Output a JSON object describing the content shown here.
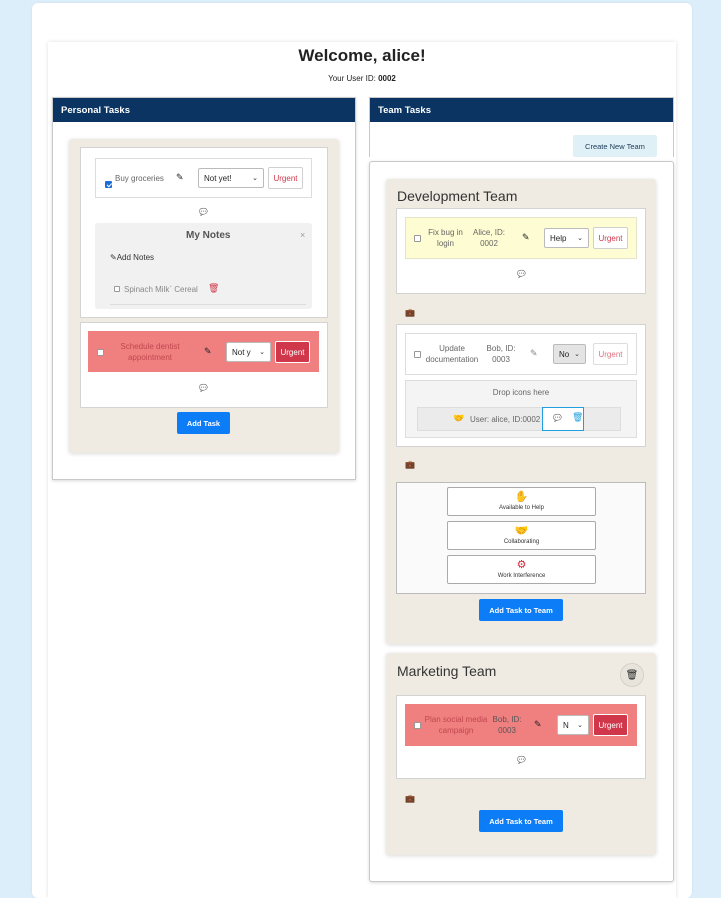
{
  "header": {
    "welcome": "Welcome, alice!",
    "user_id_label": "Your User ID: ",
    "user_id": "0002"
  },
  "personal": {
    "title": "Personal Tasks",
    "tasks": [
      {
        "label": "Buy groceries",
        "checked": true,
        "status": "Not yet!",
        "urgent": "Urgent",
        "urgent_active": false
      },
      {
        "label": "Schedule dentist appointment",
        "checked": false,
        "status": "Not y",
        "urgent": "Urgent",
        "urgent_active": true
      }
    ],
    "notes": {
      "title": "My Notes",
      "close": "×",
      "add_notes": "Add Notes",
      "items": [
        {
          "text": "Spinach Milk` Cereal",
          "checked": false
        }
      ]
    },
    "add_task": "Add Task"
  },
  "team": {
    "title": "Team Tasks",
    "create_button": "Create New Team",
    "teams": [
      {
        "name": "Development Team",
        "tasks": [
          {
            "label": "Fix bug in login",
            "assignee": "Alice, ID: 0002",
            "status": "Help",
            "urgent": "Urgent",
            "bg": "#fdfcd2"
          },
          {
            "label": "Update documentation",
            "assignee": "Bob, ID: 0003",
            "status": "No",
            "urgent": "Urgent",
            "bg": "#ffffff"
          }
        ],
        "drop_zone": {
          "label": "Drop icons here",
          "user": "User: alice, ID:0002"
        },
        "legend": [
          {
            "icon": "hand-icon",
            "glyph": "✋",
            "label": "Available to Help"
          },
          {
            "icon": "handshake-icon",
            "glyph": "🤝",
            "label": "Collaborating"
          },
          {
            "icon": "gear-icon",
            "glyph": "⚙",
            "label": "Work Interference"
          }
        ],
        "add_button": "Add Task to Team"
      },
      {
        "name": "Marketing Team",
        "tasks": [
          {
            "label": "Plan social media campaign",
            "assignee": "Bob, ID: 0003",
            "status": "N",
            "urgent": "Urgent",
            "bg": "#f08080"
          }
        ],
        "add_button": "Add Task to Team"
      }
    ]
  },
  "colors": {
    "navy": "#0b3462",
    "blue": "#0d7cf7",
    "urgent": "#d0374a",
    "salmon": "#f08080",
    "beige": "#efebe3",
    "yellow": "#fdfcd2"
  }
}
